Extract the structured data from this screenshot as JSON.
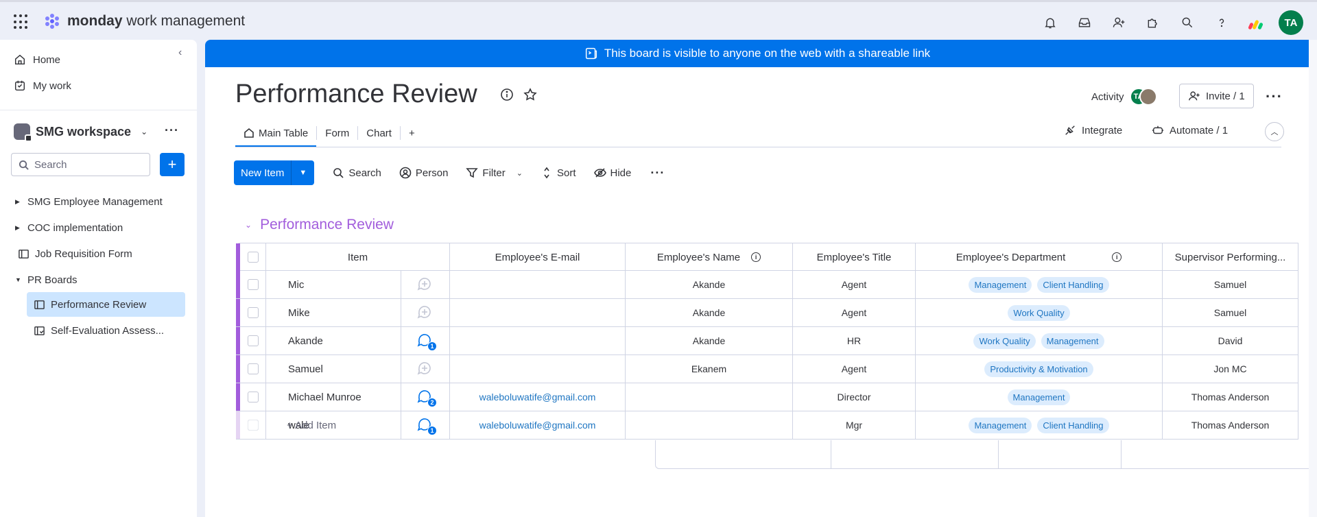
{
  "app": {
    "brand": "monday",
    "product": "work management",
    "colors": {
      "accent": "#0073ea",
      "group": "#a25ddc",
      "avatar": "#037f4c"
    },
    "user_initials": "TA"
  },
  "sidebar": {
    "home": "Home",
    "my_work": "My work",
    "workspace": "SMG workspace",
    "search_placeholder": "Search",
    "add": "+",
    "tree": [
      {
        "label": "SMG Employee Management"
      },
      {
        "label": "COC implementation"
      },
      {
        "label": "Job Requisition Form"
      },
      {
        "label": "PR Boards"
      },
      {
        "label": "Performance Review"
      },
      {
        "label": "Self-Evaluation Assess..."
      }
    ]
  },
  "banner": {
    "text": "This board is visible to anyone on the web with a shareable link"
  },
  "board": {
    "title": "Performance Review",
    "activity": "Activity",
    "activity_avatar": "TA",
    "invite": "Invite / 1",
    "tabs": [
      {
        "label": "Main Table"
      },
      {
        "label": "Form"
      },
      {
        "label": "Chart"
      }
    ],
    "add_tab": "+",
    "integrate": "Integrate",
    "automate": "Automate / 1"
  },
  "toolbar": {
    "new_item": "New Item",
    "search": "Search",
    "person": "Person",
    "filter": "Filter",
    "sort": "Sort",
    "hide": "Hide"
  },
  "group": {
    "title": "Performance Review",
    "columns": {
      "item": "Item",
      "email": "Employee's E-mail",
      "name": "Employee's Name",
      "title": "Employee's Title",
      "dept": "Employee's Department",
      "supervisor": "Supervisor Performing..."
    },
    "rows": [
      {
        "item": "Mic",
        "updates": "",
        "email": "",
        "name": "Akande",
        "title": "Agent",
        "dept": [
          "Management",
          "Client Handling"
        ],
        "supervisor": "Samuel"
      },
      {
        "item": "Mike",
        "updates": "",
        "email": "",
        "name": "Akande",
        "title": "Agent",
        "dept": [
          "Work Quality"
        ],
        "supervisor": "Samuel"
      },
      {
        "item": "Akande",
        "updates": "1",
        "email": "",
        "name": "Akande",
        "title": "HR",
        "dept": [
          "Work Quality",
          "Management"
        ],
        "supervisor": "David"
      },
      {
        "item": "Samuel",
        "updates": "",
        "email": "",
        "name": "Ekanem",
        "title": "Agent",
        "dept": [
          "Productivity & Motivation"
        ],
        "supervisor": "Jon MC"
      },
      {
        "item": "Michael Munroe",
        "updates": "2",
        "email": "waleboluwatife@gmail.com",
        "name": "",
        "title": "Director",
        "dept": [
          "Management"
        ],
        "supervisor": "Thomas Anderson"
      },
      {
        "item": "wale",
        "updates": "1",
        "email": "waleboluwatife@gmail.com",
        "name": "",
        "title": "Mgr",
        "dept": [
          "Management",
          "Client Handling"
        ],
        "supervisor": "Thomas Anderson"
      }
    ],
    "add_item": "+ Add Item"
  }
}
